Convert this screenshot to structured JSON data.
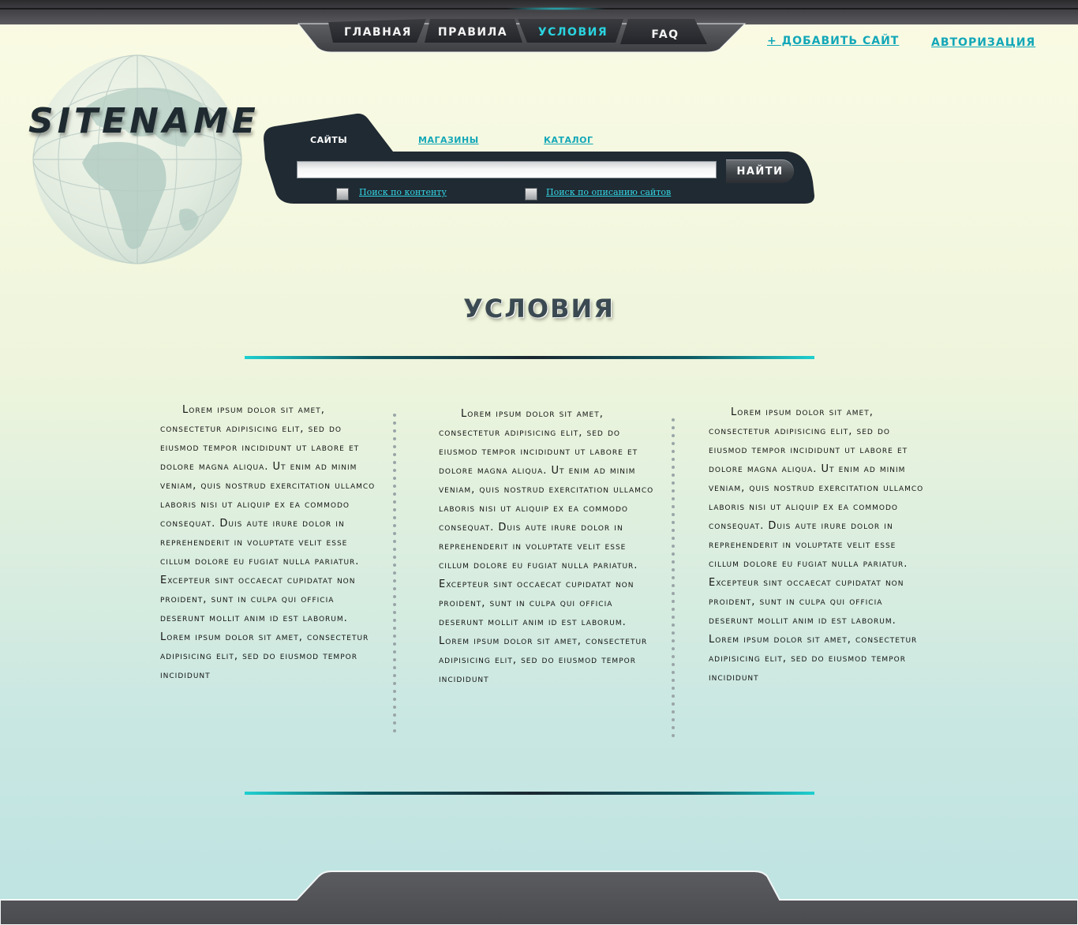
{
  "nav": {
    "tabs": [
      {
        "label": "ГЛАВНАЯ",
        "active": false
      },
      {
        "label": "ПРАВИЛА",
        "active": false
      },
      {
        "label": "УСЛОВИЯ",
        "active": true
      },
      {
        "label": "FAQ",
        "active": false
      }
    ],
    "add_site_icon": "plus-icon",
    "add_site_label": "+ ДОБАВИТЬ САЙТ",
    "login_label": "АВТОРИЗАЦИЯ"
  },
  "logo": {
    "text": "SITENAME",
    "background_icon": "globe-icon"
  },
  "search": {
    "tabs": [
      {
        "label": "САЙТЫ",
        "active": true
      },
      {
        "label": "МАГАЗИНЫ",
        "active": false
      },
      {
        "label": "КАТАЛОГ",
        "active": false
      }
    ],
    "query": "",
    "button_label": "НАЙТИ",
    "options": [
      {
        "label": "Поиск по контенту",
        "checked": false
      },
      {
        "label": "Поиск по описанию сайтов",
        "checked": false
      }
    ]
  },
  "page": {
    "heading": "УСЛОВИЯ"
  },
  "columns": [
    {
      "text": "Lorem ipsum dolor sit amet, consectetur adipisicing elit, sed do eiusmod tempor incididunt ut labore et dolore magna aliqua. Ut enim ad minim veniam, quis nostrud exercitation ullamco laboris nisi ut aliquip ex ea commodo consequat. Duis aute irure dolor in reprehenderit in voluptate velit esse cillum dolore eu fugiat nulla pariatur. Excepteur sint occaecat cupidatat non proident, sunt in culpa qui officia deserunt mollit anim id est laborum. Lorem ipsum dolor sit amet, consectetur adipisicing elit, sed do eiusmod tempor incididunt"
    },
    {
      "text": "Lorem ipsum dolor sit amet, consectetur adipisicing elit, sed do eiusmod tempor incididunt ut labore et dolore magna aliqua. Ut enim ad minim veniam, quis nostrud exercitation ullamco laboris nisi ut aliquip ex ea commodo consequat. Duis aute irure dolor in reprehenderit in voluptate velit esse cillum dolore eu fugiat nulla pariatur. Excepteur sint occaecat cupidatat non proident, sunt in culpa qui officia deserunt mollit anim id est laborum. Lorem ipsum dolor sit amet, consectetur adipisicing elit, sed do eiusmod tempor incididunt"
    },
    {
      "text": "Lorem ipsum dolor sit amet, consectetur adipisicing elit, sed do eiusmod tempor incididunt ut labore et dolore magna aliqua. Ut enim ad minim veniam, quis nostrud exercitation ullamco laboris nisi ut aliquip ex ea commodo consequat. Duis aute irure dolor in reprehenderit in voluptate velit esse cillum dolore eu fugiat nulla pariatur. Excepteur sint occaecat cupidatat non proident, sunt in culpa qui officia deserunt mollit anim id est laborum. Lorem ipsum dolor sit amet, consectetur adipisicing elit, sed do eiusmod tempor incididunt"
    }
  ],
  "colors": {
    "accent": "#13a7b8",
    "active_tab": "#2ad4e0",
    "panel": "#1f2a33",
    "bar": "#4f4f53"
  }
}
